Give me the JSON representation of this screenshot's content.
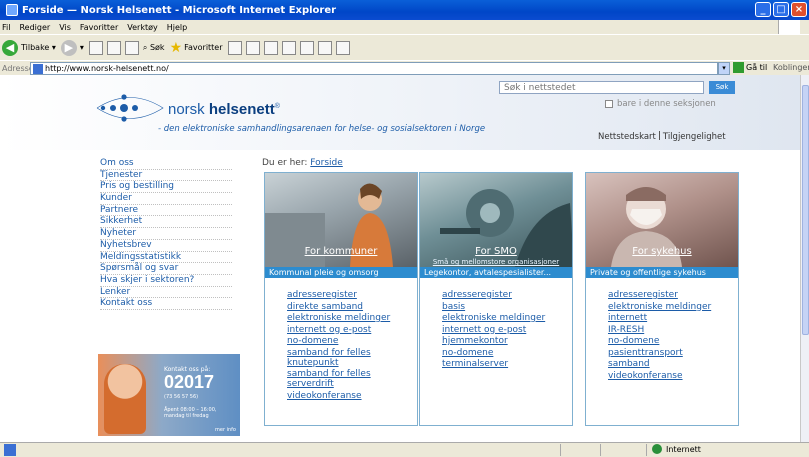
{
  "window": {
    "title": "Forside — Norsk Helsenett - Microsoft Internet Explorer"
  },
  "menu": [
    "Fil",
    "Rediger",
    "Vis",
    "Favoritter",
    "Verktøy",
    "Hjelp"
  ],
  "toolbar": {
    "back": "Tilbake",
    "search": "Søk",
    "favorites": "Favoritter"
  },
  "address": {
    "label": "Adresse",
    "url": "http://www.norsk-helsenett.no/",
    "go": "Gå til",
    "links": "Koblinger"
  },
  "status": {
    "zone": "Internett"
  },
  "site": {
    "logo_prefix": "norsk ",
    "logo_bold": "helsenett",
    "logo_reg": "®",
    "tagline": "- den elektroniske samhandlingsarenaen for helse- og sosialsektoren i Norge",
    "search_placeholder": "Søk i nettstedet",
    "search_button": "Søk",
    "search_scope": "bare i denne seksjonen",
    "sitemap": "Nettstedskart",
    "accessibility": "Tilgjengelighet"
  },
  "nav": [
    "Om oss",
    "Tjenester",
    "Pris og bestilling",
    "Kunder",
    "Partnere",
    "Sikkerhet",
    "Nyheter",
    "Nyhetsbrev",
    "Meldingsstatistikk",
    "Spørsmål og svar",
    "Hva skjer i sektoren?",
    "Lenker",
    "Kontakt oss"
  ],
  "contact": {
    "heading": "Kontakt oss på:",
    "number": "02017",
    "alt_number": "(73 56 57 56)",
    "hours": "Åpent 08:00 – 16:00, mandag til fredag",
    "more": "mer info"
  },
  "breadcrumb": {
    "prefix": "Du er her: ",
    "current": "Forside"
  },
  "columns": [
    {
      "title": "For kommuner",
      "subtitle": "",
      "band": "Kommunal pleie og omsorg",
      "links": [
        "adresseregister",
        "direkte samband",
        "elektroniske meldinger",
        "internett og e-post",
        "no-domene",
        "samband for felles knutepunkt",
        "samband for felles serverdrift",
        "videokonferanse"
      ]
    },
    {
      "title": "For SMO",
      "subtitle": "Små og mellomstore organisasjoner",
      "band": "Legekontor, avtalespesialister...",
      "links": [
        "adresseregister",
        "basis",
        "elektroniske meldinger",
        "internett og e-post",
        "hjemmekontor",
        "no-domene",
        "terminalserver"
      ]
    },
    {
      "title": "For sykehus",
      "subtitle": "",
      "band": "Private og offentlige sykehus",
      "links": [
        "adresseregister",
        "elektroniske meldinger",
        "internett",
        "IR-RESH",
        "no-domene",
        "pasienttransport",
        "samband",
        "videokonferanse"
      ]
    }
  ]
}
